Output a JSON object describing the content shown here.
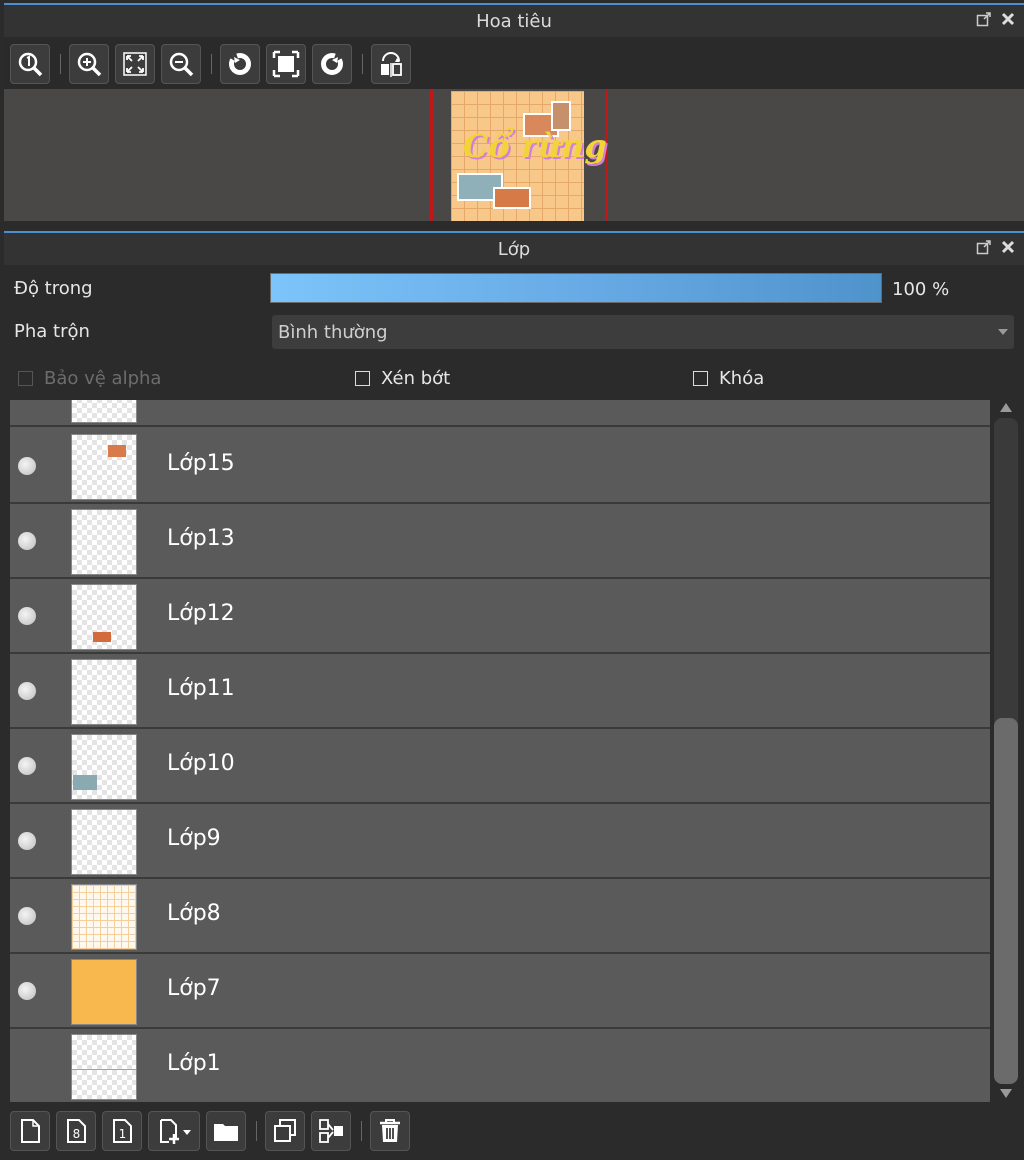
{
  "navigator": {
    "title": "Hoa tiêu",
    "preview_text": "Cổ rừng",
    "toolbar": [
      "zoom-actual-icon",
      "zoom-in-icon",
      "fit-window-icon",
      "zoom-out-icon",
      "rotate-left-icon",
      "fit-canvas-icon",
      "rotate-right-icon",
      "flip-horizontal-icon"
    ]
  },
  "layers_panel": {
    "title": "Lớp",
    "opacity_label": "Độ trong",
    "opacity": 100,
    "opacity_text": "100 %",
    "blend_label": "Pha trộn",
    "blend_value": "Bình thường",
    "protect_alpha_label": "Bảo vệ alpha",
    "clip_label": "Xén bớt",
    "lock_label": "Khóa",
    "layers": [
      {
        "name": "Lớp15",
        "visible": true
      },
      {
        "name": "Lớp13",
        "visible": true
      },
      {
        "name": "Lớp12",
        "visible": true
      },
      {
        "name": "Lớp11",
        "visible": true
      },
      {
        "name": "Lớp10",
        "visible": true
      },
      {
        "name": "Lớp9",
        "visible": true
      },
      {
        "name": "Lớp8",
        "visible": true
      },
      {
        "name": "Lớp7",
        "visible": true
      },
      {
        "name": "Lớp1",
        "visible": false
      }
    ],
    "bottom_toolbar": [
      "new-layer-icon",
      "new-8bit-layer-icon",
      "new-1bit-layer-icon",
      "add-layer-menu-icon",
      "new-folder-icon",
      "duplicate-layer-icon",
      "merge-down-icon",
      "delete-layer-icon"
    ]
  },
  "colors": {
    "accent": "#4a8fd0",
    "canvas_bg": "#f8c88a",
    "layer7_fill": "#f8b84e",
    "nav_frame": "#c01818"
  }
}
